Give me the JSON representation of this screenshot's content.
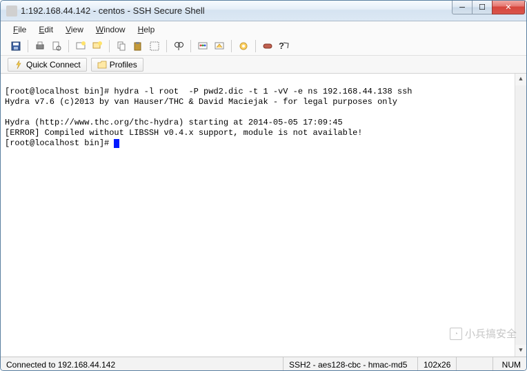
{
  "window": {
    "title": "1:192.168.44.142 - centos - SSH Secure Shell"
  },
  "menu": {
    "file": "File",
    "edit": "Edit",
    "view": "View",
    "window": "Window",
    "help": "Help"
  },
  "toolbar_icons": {
    "save": "save-icon",
    "print": "print-icon",
    "printpreview": "printpreview-icon",
    "new": "newterminal-icon",
    "newwin": "newwindow-icon",
    "copy": "copy-icon",
    "paste": "paste-icon",
    "selectall": "selectall-icon",
    "find": "find-icon",
    "colorprofile": "colorprofile-icon",
    "tunnel": "tunnel-icon",
    "settings": "settings-icon",
    "disconnect": "disconnect-icon",
    "help": "help-icon"
  },
  "shortcuts": {
    "quick_connect": "Quick Connect",
    "profiles": "Profiles"
  },
  "terminal": {
    "line1": "[root@localhost bin]# hydra -l root  -P pwd2.dic -t 1 -vV -e ns 192.168.44.138 ssh",
    "line2": "Hydra v7.6 (c)2013 by van Hauser/THC & David Maciejak - for legal purposes only",
    "line3": "",
    "line4": "Hydra (http://www.thc.org/thc-hydra) starting at 2014-05-05 17:09:45",
    "line5": "[ERROR] Compiled without LIBSSH v0.4.x support, module is not available!",
    "line6": "[root@localhost bin]# "
  },
  "status": {
    "connection": "Connected to 192.168.44.142",
    "protocol": "SSH2 - aes128-cbc - hmac-md5",
    "size": "102x26",
    "numlock": "NUM"
  },
  "watermark": "小兵搞安全"
}
